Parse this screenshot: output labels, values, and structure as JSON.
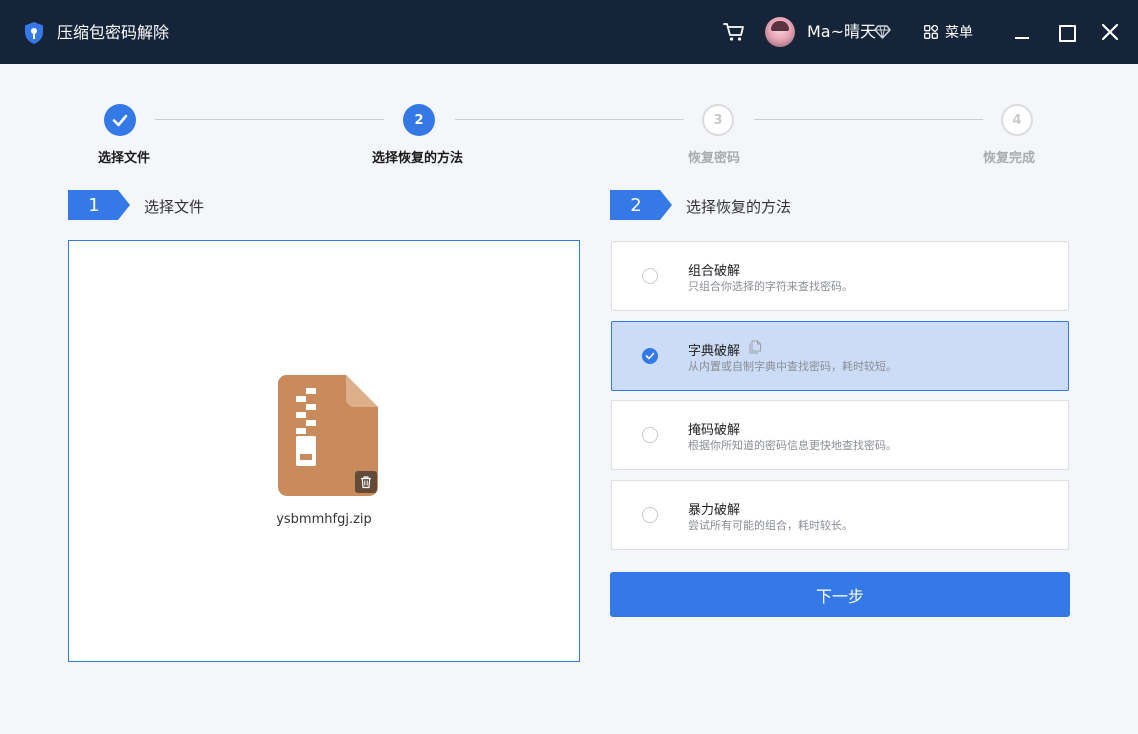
{
  "titlebar": {
    "app_title": "压缩包密码解除",
    "username": "Ma~晴天",
    "menu_label": "菜单",
    "icons": [
      "shield-key-icon",
      "cart-icon",
      "avatar",
      "vip-diamond-icon",
      "grid-menu-icon",
      "minimize-icon",
      "maximize-icon",
      "close-icon"
    ]
  },
  "steps": [
    {
      "number": "",
      "label": "选择文件",
      "state": "done"
    },
    {
      "number": "2",
      "label": "选择恢复的方法",
      "state": "active"
    },
    {
      "number": "3",
      "label": "恢复密码",
      "state": "todo"
    },
    {
      "number": "4",
      "label": "恢复完成",
      "state": "todo"
    }
  ],
  "left_section": {
    "number": "1",
    "title": "选择文件"
  },
  "right_section": {
    "number": "2",
    "title": "选择恢复的方法"
  },
  "file": {
    "name": "ysbmmhfgj.zip"
  },
  "options": [
    {
      "title": "组合破解",
      "desc": "只组合你选择的字符来查找密码。",
      "selected": false
    },
    {
      "title": "字典破解",
      "desc": "从内置或自制字典中查找密码，耗时较短。",
      "selected": true
    },
    {
      "title": "掩码破解",
      "desc": "根据你所知道的密码信息更快地查找密码。",
      "selected": false
    },
    {
      "title": "暴力破解",
      "desc": "尝试所有可能的组合，耗时较长。",
      "selected": false
    }
  ],
  "next_button": "下一步",
  "colors": {
    "titlebar": "#16243a",
    "accent": "#3479e6",
    "selected_bg": "#ccdbf6",
    "zip_brown": "#c98b5c",
    "background": "#f4f6f9"
  }
}
